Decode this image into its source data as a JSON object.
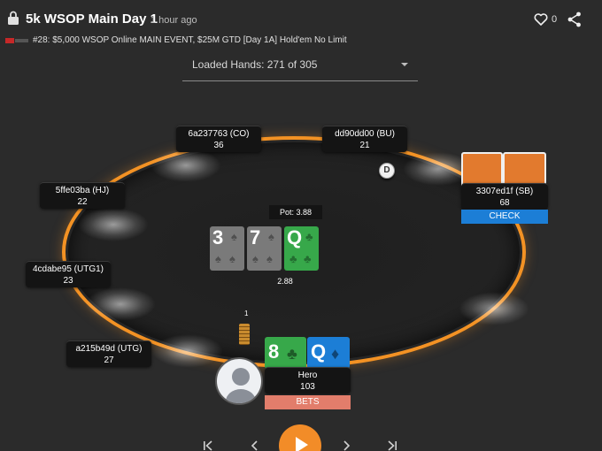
{
  "header": {
    "title": "5k WSOP Main Day 1",
    "time": "1 hour ago",
    "like_count": "0",
    "subtitle": "#28: $5,000 WSOP Online MAIN EVENT, $25M GTD [Day 1A] Hold'em No Limit"
  },
  "hands_select": {
    "label": "Loaded Hands: 271 of 305"
  },
  "table": {
    "pot_label": "Pot: 3.88",
    "pot_amount": "2.88",
    "dealer_button": "D",
    "bet_chip_count": "1",
    "board": [
      {
        "rank": "3",
        "color": "grey"
      },
      {
        "rank": "7",
        "color": "grey"
      },
      {
        "rank": "Q",
        "color": "green"
      }
    ]
  },
  "seats": {
    "co": {
      "name": "6a237763 (CO)",
      "stack": "36"
    },
    "bu": {
      "name": "dd90dd00 (BU)",
      "stack": "21"
    },
    "hj": {
      "name": "5ffe03ba (HJ)",
      "stack": "22"
    },
    "sb": {
      "name": "3307ed1f (SB)",
      "stack": "68",
      "action": "CHECK"
    },
    "utg1": {
      "name": "4cdabe95 (UTG1)",
      "stack": "23"
    },
    "utg": {
      "name": "a215b49d (UTG)",
      "stack": "27"
    },
    "hero": {
      "name": "Hero",
      "stack": "103",
      "action": "BETS",
      "cards": [
        {
          "rank": "8",
          "color": "green"
        },
        {
          "rank": "Q",
          "color": "blue"
        }
      ]
    }
  },
  "colors": {
    "background": "#2b2b2b",
    "table_rail": "#f39224",
    "check": "#1c7ed6",
    "bets": "#e27d6b",
    "play_button": "#f28c28"
  },
  "icons": [
    "lock-icon",
    "heart-icon",
    "share-icon",
    "skip-start-icon",
    "prev-icon",
    "play-icon",
    "next-icon",
    "skip-end-icon"
  ]
}
